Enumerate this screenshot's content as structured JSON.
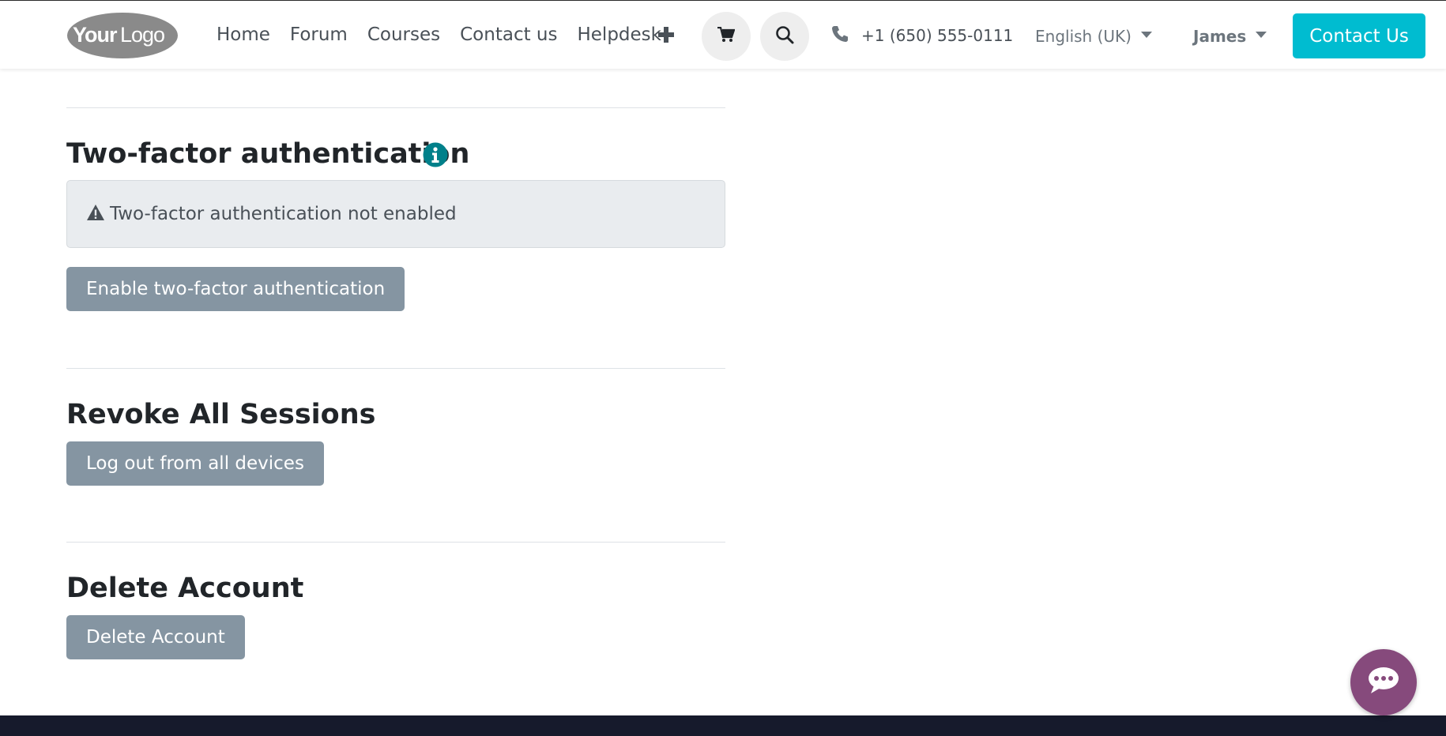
{
  "header": {
    "logo_alt": "YourLogo",
    "nav": [
      "Home",
      "Forum",
      "Courses",
      "Contact us",
      "Helpdesk"
    ],
    "phone": "+1 (650) 555-0111",
    "language": "English (UK)",
    "user": "James",
    "contact_button": "Contact Us"
  },
  "two_factor": {
    "title": "Two-factor authentication",
    "status": "Two-factor authentication not enabled",
    "enable_button": "Enable two-factor authentication"
  },
  "sessions": {
    "title": "Revoke All Sessions",
    "logout_button": "Log out from all devices"
  },
  "delete_account": {
    "title": "Delete Account",
    "delete_button": "Delete Account"
  },
  "colors": {
    "accent": "#00bcd0",
    "info_icon": "#00808a",
    "button_gray": "#8595a2",
    "chat": "#864a7c",
    "footer": "#161a2c"
  },
  "icons": {
    "plus": "plus-icon",
    "cart": "cart-icon",
    "search": "search-icon",
    "phone": "phone-icon",
    "info": "info-icon",
    "warning": "warning-icon",
    "chat": "chat-icon"
  }
}
